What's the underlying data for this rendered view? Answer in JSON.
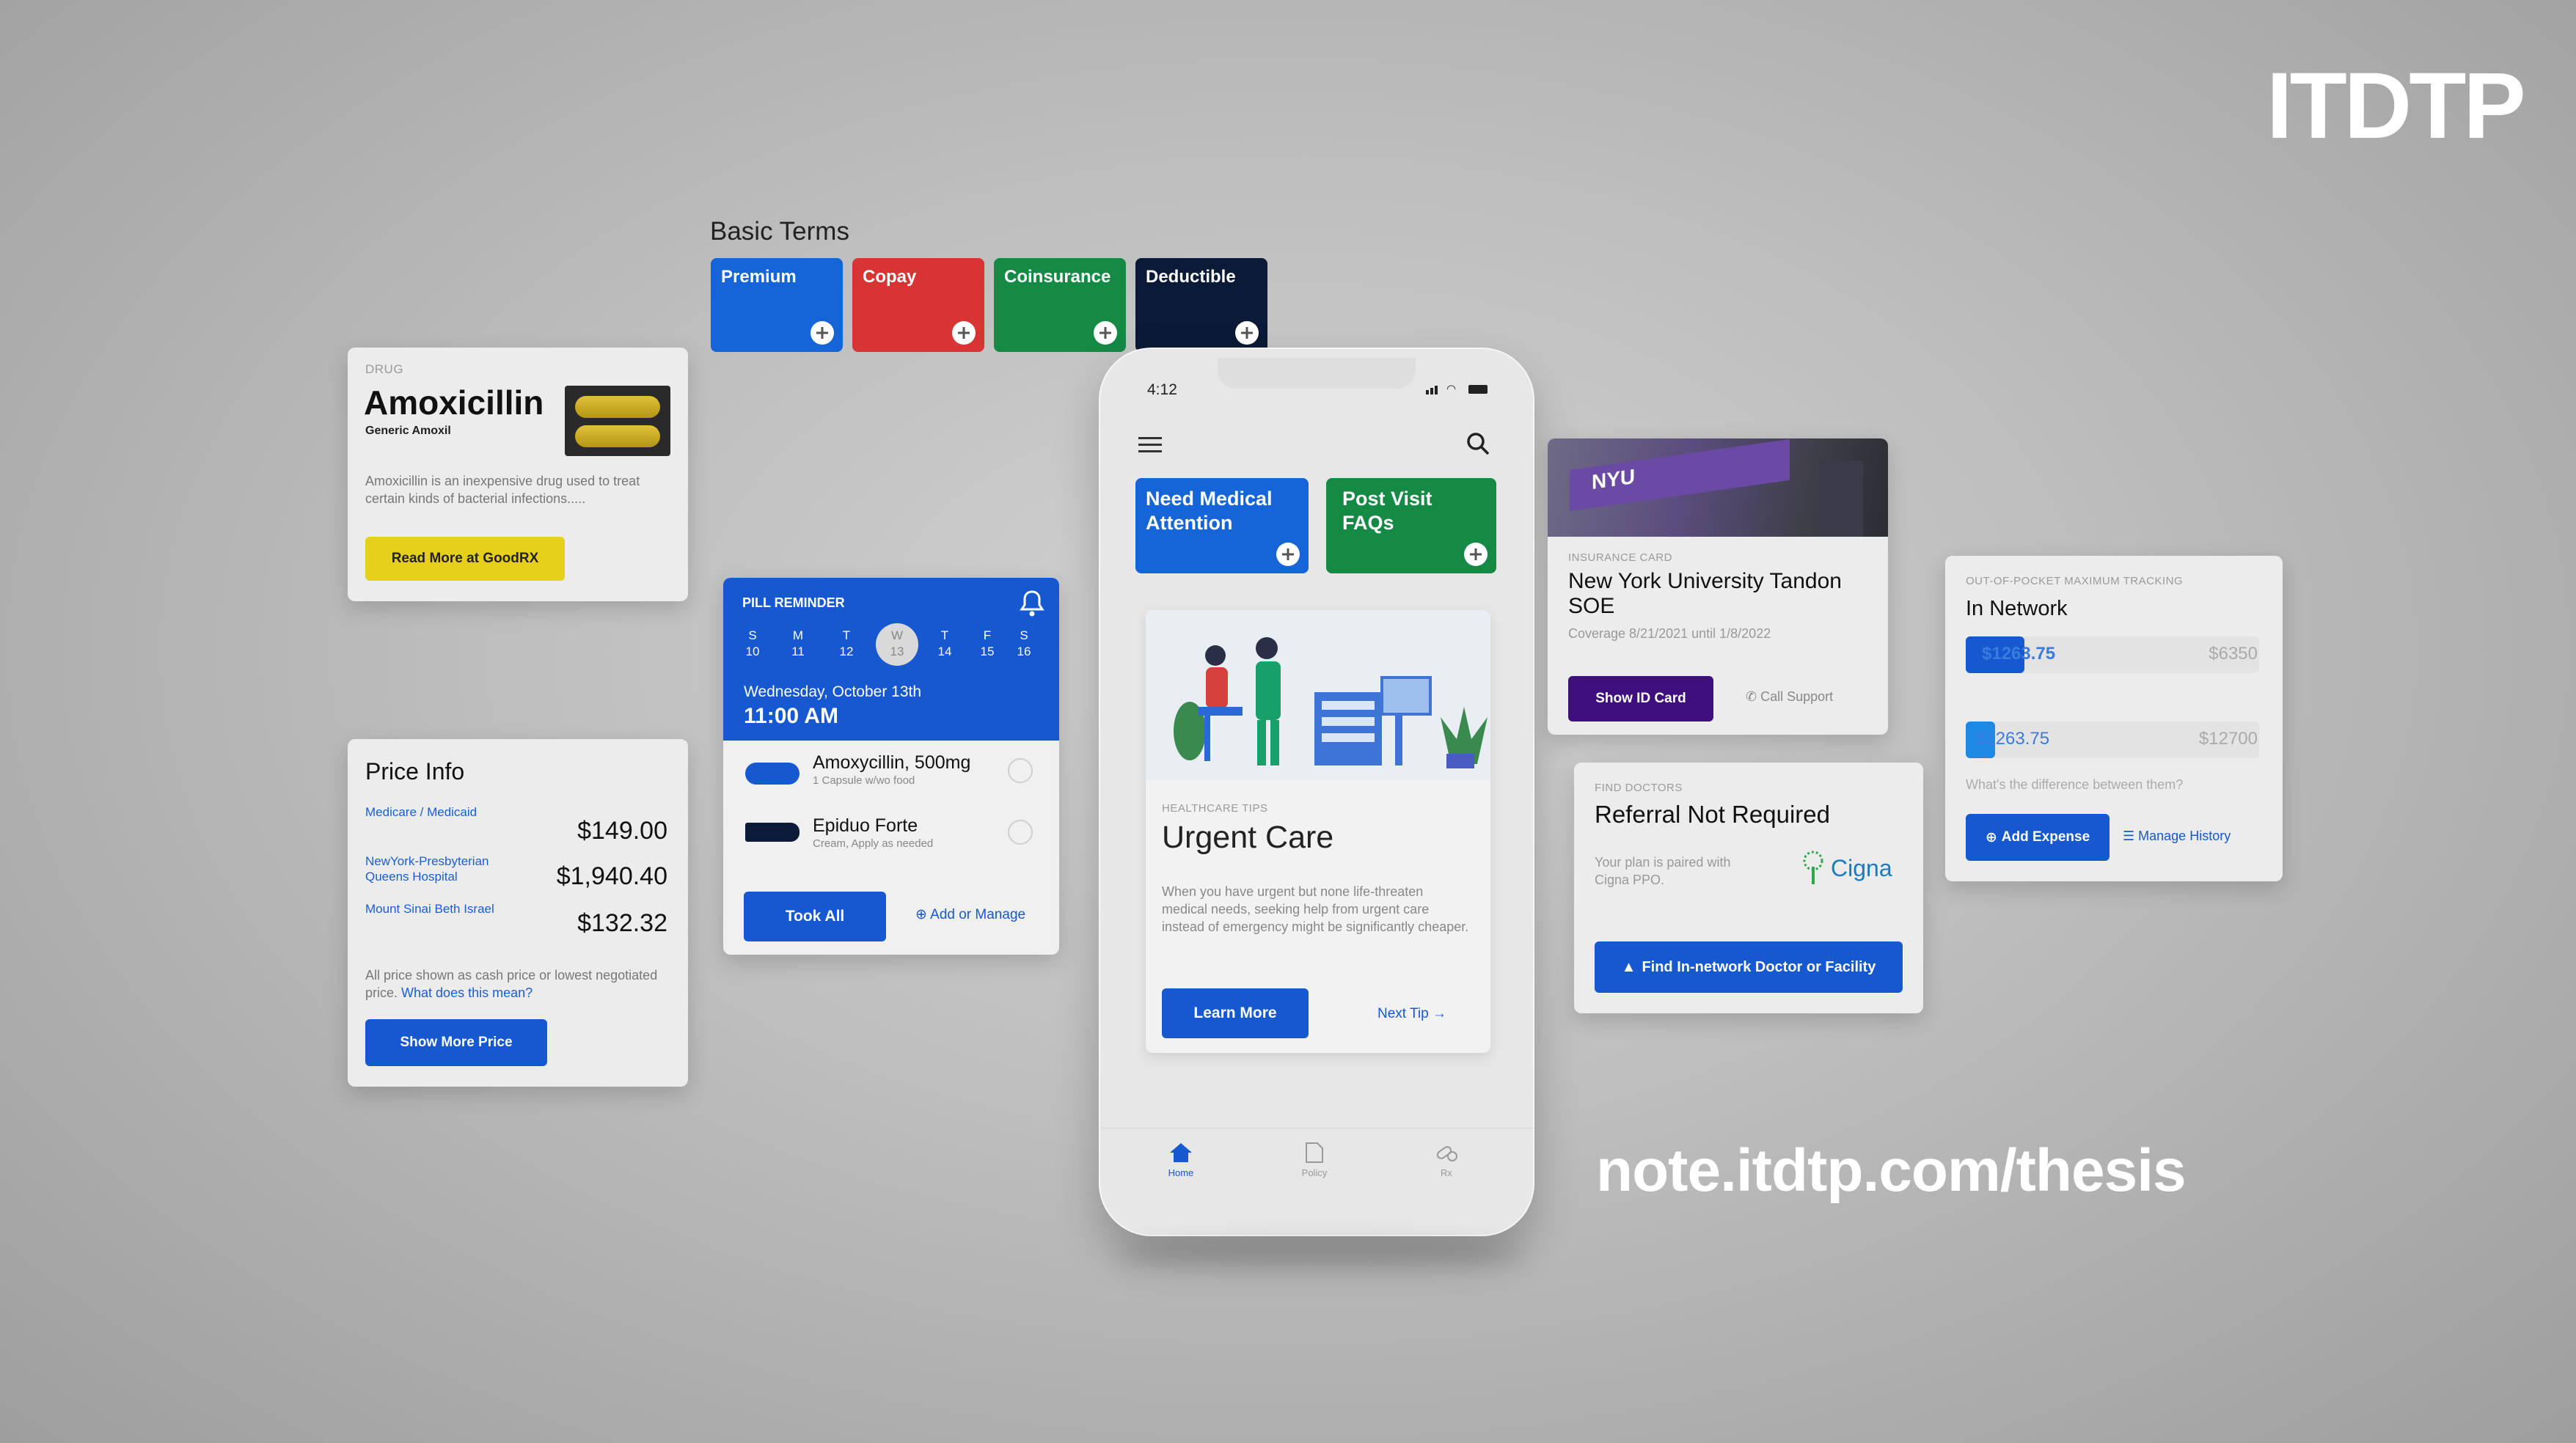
{
  "brand": {
    "logo": "ITDTP",
    "url": "note.itdtp.com/thesis"
  },
  "basic_terms": {
    "title": "Basic Terms",
    "items": [
      {
        "label": "Premium",
        "color": "#1565d8"
      },
      {
        "label": "Copay",
        "color": "#d83434"
      },
      {
        "label": "Coinsurance",
        "color": "#148a45"
      },
      {
        "label": "Deductible",
        "color": "#0b1a36"
      }
    ]
  },
  "drug": {
    "tag": "DRUG",
    "name": "Amoxicillin",
    "generic": "Generic Amoxil",
    "description": "Amoxicillin is an inexpensive drug used to treat certain kinds of bacterial infections.....",
    "button": "Read More at GoodRX"
  },
  "price_info": {
    "title": "Price Info",
    "rows": [
      {
        "provider": "Medicare / Medicaid",
        "price": "$149.00"
      },
      {
        "provider": "NewYork-Presbyterian Queens Hospital",
        "price": "$1,940.40"
      },
      {
        "provider": "Mount Sinai Beth Israel",
        "price": "$132.32"
      }
    ],
    "note": "All price shown as cash price or lowest negotiated price.",
    "note_link": "What does this mean?",
    "button": "Show More Price"
  },
  "pill_reminder": {
    "tag": "PILL REMINDER",
    "days": [
      {
        "d": "S",
        "n": "10"
      },
      {
        "d": "M",
        "n": "11"
      },
      {
        "d": "T",
        "n": "12"
      },
      {
        "d": "W",
        "n": "13"
      },
      {
        "d": "T",
        "n": "14"
      },
      {
        "d": "F",
        "n": "15"
      },
      {
        "d": "S",
        "n": "16"
      }
    ],
    "date": "Wednesday, October 13th",
    "time": "11:00 AM",
    "meds": [
      {
        "name": "Amoxycillin, 500mg",
        "sub": "1 Capsule w/wo food"
      },
      {
        "name": "Epiduo Forte",
        "sub": "Cream, Apply as needed"
      }
    ],
    "took_all": "Took All",
    "add_manage": "Add or Manage"
  },
  "phone": {
    "time": "4:12",
    "tiles": [
      {
        "label": "Need Medical Attention",
        "color": "#1565d8"
      },
      {
        "label": "Post Visit FAQs",
        "color": "#148a45"
      }
    ],
    "tip": {
      "tag": "HEALTHCARE TIPS",
      "title": "Urgent Care",
      "body": "When you have urgent but none life-threaten medical needs, seeking help from urgent care instead of emergency might be significantly cheaper.",
      "learn": "Learn More",
      "next": "Next Tip →"
    },
    "nav": [
      {
        "label": "Home"
      },
      {
        "label": "Policy"
      },
      {
        "label": "Rx"
      }
    ]
  },
  "insurance": {
    "tag": "INSURANCE CARD",
    "name": "New York University Tandon SOE",
    "coverage": "Coverage 8/21/2021 until 1/8/2022",
    "show_id": "Show ID Card",
    "support": "Call Support"
  },
  "doctors": {
    "tag": "FIND DOCTORS",
    "title": "Referral Not Required",
    "body": "Your plan is paired with Cigna PPO.",
    "partner": "Cigna",
    "button": "Find In-network Doctor or Facility"
  },
  "oop": {
    "tag": "OUT-OF-POCKET MAXIMUM TRACKING",
    "title": "In Network",
    "bars": [
      {
        "value": "$1263.75",
        "max": "$6350",
        "fraction": 0.2
      },
      {
        "value": "$1263.75",
        "max": "$12700",
        "fraction": 0.1
      }
    ],
    "question": "What's the difference between them?",
    "add": "Add Expense",
    "history": "Manage History"
  }
}
